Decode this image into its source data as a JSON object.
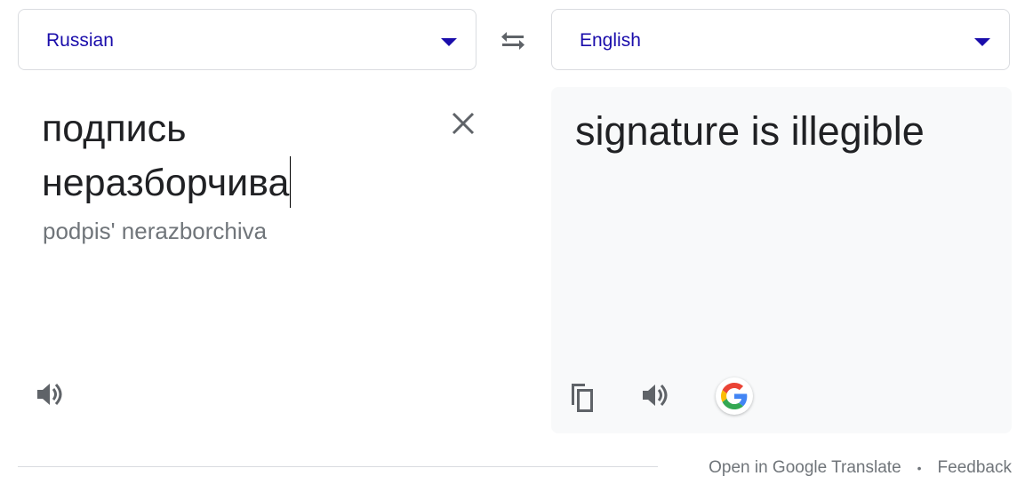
{
  "source_language": {
    "label": "Russian",
    "icon": "dropdown-arrow-icon"
  },
  "target_language": {
    "label": "English",
    "icon": "dropdown-arrow-icon"
  },
  "swap": {
    "icon": "swap-arrows-icon"
  },
  "source": {
    "text": "подпись\nнеразборчива",
    "transliteration": "podpis' nerazborchiva",
    "clear_icon": "close-icon",
    "speak_icon": "speaker-icon"
  },
  "target": {
    "text": "signature is illegible",
    "copy_icon": "copy-icon",
    "speak_icon": "speaker-icon",
    "google_icon": "google-g-icon"
  },
  "footer": {
    "open_link": "Open in Google Translate",
    "separator": "•",
    "feedback_link": "Feedback"
  },
  "colors": {
    "link_blue": "#1a0dab",
    "icon_grey": "#5f6368",
    "panel_bg": "#f8f9fa",
    "muted_text": "#70757a"
  }
}
